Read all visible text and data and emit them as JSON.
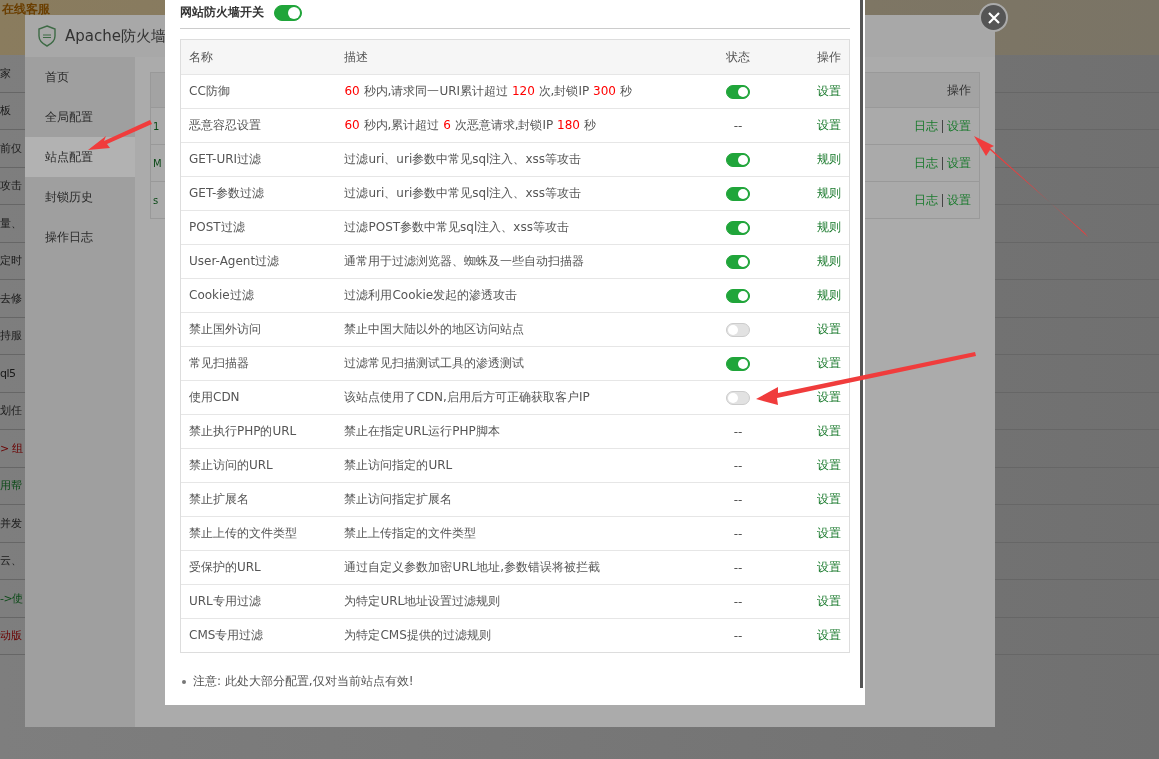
{
  "background_page": {
    "top_link": "在线客服",
    "fragments": [
      {
        "text": "家",
        "kind": "plain"
      },
      {
        "text": "板",
        "kind": "plain"
      },
      {
        "text": "前仅",
        "kind": "plain"
      },
      {
        "text": "攻击",
        "kind": "plain"
      },
      {
        "text": "量、",
        "kind": "plain"
      },
      {
        "text": "定时",
        "kind": "plain"
      },
      {
        "text": "去修",
        "kind": "plain"
      },
      {
        "text": "持服",
        "kind": "plain"
      },
      {
        "text": "ql5",
        "kind": "plain"
      },
      {
        "text": "划任",
        "kind": "plain"
      },
      {
        "text": "> 组",
        "kind": "alert"
      },
      {
        "text": "用帮",
        "kind": "link"
      },
      {
        "text": "并发",
        "kind": "plain"
      },
      {
        "text": "云、",
        "kind": "plain"
      },
      {
        "text": "->使",
        "kind": "link"
      },
      {
        "text": "动版",
        "kind": "alert"
      }
    ]
  },
  "waf_window": {
    "title": "Apache防火墙",
    "sidebar": {
      "items": [
        {
          "label": "首页",
          "selected": false
        },
        {
          "label": "全局配置",
          "selected": false
        },
        {
          "label": "站点配置",
          "selected": true
        },
        {
          "label": "封锁历史",
          "selected": false
        },
        {
          "label": "操作日志",
          "selected": false
        }
      ]
    },
    "sites_table": {
      "columns": [
        "操作"
      ],
      "rows": [
        {
          "column_1": "1",
          "log": "日志",
          "settings": "设置"
        },
        {
          "column_1": "M",
          "log": "日志",
          "settings": "设置"
        },
        {
          "column_1": "s",
          "log": "日志",
          "settings": "设置"
        }
      ]
    }
  },
  "modal": {
    "master_switch": {
      "label": "网站防火墙开关",
      "on": true
    },
    "table": {
      "columns": [
        "名称",
        "描述",
        "状态",
        "操作"
      ],
      "rows": [
        {
          "name": "CC防御",
          "description": [
            {
              "text": "60",
              "kind": "number"
            },
            {
              "text": " 秒内,请求同一URI累计超过 ",
              "kind": "text"
            },
            {
              "text": "120",
              "kind": "number"
            },
            {
              "text": " 次,封锁IP ",
              "kind": "text"
            },
            {
              "text": "300",
              "kind": "number"
            },
            {
              "text": " 秒",
              "kind": "text"
            }
          ],
          "status": {
            "kind": "toggle",
            "on": true
          },
          "action": "设置"
        },
        {
          "name": "恶意容忍设置",
          "description": [
            {
              "text": "60",
              "kind": "number"
            },
            {
              "text": " 秒内,累计超过 ",
              "kind": "text"
            },
            {
              "text": "6",
              "kind": "number"
            },
            {
              "text": " 次恶意请求,封锁IP ",
              "kind": "text"
            },
            {
              "text": "180",
              "kind": "number"
            },
            {
              "text": " 秒",
              "kind": "text"
            }
          ],
          "status": {
            "kind": "text",
            "text": "--"
          },
          "action": "设置"
        },
        {
          "name": "GET-URI过滤",
          "description": [
            {
              "text": "过滤uri、uri参数中常见sql注入、xss等攻击",
              "kind": "text"
            }
          ],
          "status": {
            "kind": "toggle",
            "on": true
          },
          "action": "规则"
        },
        {
          "name": "GET-参数过滤",
          "description": [
            {
              "text": "过滤uri、uri参数中常见sql注入、xss等攻击",
              "kind": "text"
            }
          ],
          "status": {
            "kind": "toggle",
            "on": true
          },
          "action": "规则"
        },
        {
          "name": "POST过滤",
          "description": [
            {
              "text": "过滤POST参数中常见sql注入、xss等攻击",
              "kind": "text"
            }
          ],
          "status": {
            "kind": "toggle",
            "on": true
          },
          "action": "规则"
        },
        {
          "name": "User-Agent过滤",
          "description": [
            {
              "text": "通常用于过滤浏览器、蜘蛛及一些自动扫描器",
              "kind": "text"
            }
          ],
          "status": {
            "kind": "toggle",
            "on": true
          },
          "action": "规则"
        },
        {
          "name": "Cookie过滤",
          "description": [
            {
              "text": "过滤利用Cookie发起的渗透攻击",
              "kind": "text"
            }
          ],
          "status": {
            "kind": "toggle",
            "on": true
          },
          "action": "规则"
        },
        {
          "name": "禁止国外访问",
          "description": [
            {
              "text": "禁止中国大陆以外的地区访问站点",
              "kind": "text"
            }
          ],
          "status": {
            "kind": "toggle",
            "on": false
          },
          "action": "设置"
        },
        {
          "name": "常见扫描器",
          "description": [
            {
              "text": "过滤常见扫描测试工具的渗透测试",
              "kind": "text"
            }
          ],
          "status": {
            "kind": "toggle",
            "on": true
          },
          "action": "设置"
        },
        {
          "name": "使用CDN",
          "description": [
            {
              "text": "该站点使用了CDN,启用后方可正确获取客户IP",
              "kind": "text"
            }
          ],
          "status": {
            "kind": "toggle",
            "on": false
          },
          "action": "设置"
        },
        {
          "name": "禁止执行PHP的URL",
          "description": [
            {
              "text": "禁止在指定URL运行PHP脚本",
              "kind": "text"
            }
          ],
          "status": {
            "kind": "text",
            "text": "--"
          },
          "action": "设置"
        },
        {
          "name": "禁止访问的URL",
          "description": [
            {
              "text": "禁止访问指定的URL",
              "kind": "text"
            }
          ],
          "status": {
            "kind": "text",
            "text": "--"
          },
          "action": "设置"
        },
        {
          "name": "禁止扩展名",
          "description": [
            {
              "text": "禁止访问指定扩展名",
              "kind": "text"
            }
          ],
          "status": {
            "kind": "text",
            "text": "--"
          },
          "action": "设置"
        },
        {
          "name": "禁止上传的文件类型",
          "description": [
            {
              "text": "禁止上传指定的文件类型",
              "kind": "text"
            }
          ],
          "status": {
            "kind": "text",
            "text": "--"
          },
          "action": "设置"
        },
        {
          "name": "受保护的URL",
          "description": [
            {
              "text": "通过自定义参数加密URL地址,参数错误将被拦截",
              "kind": "text"
            }
          ],
          "status": {
            "kind": "text",
            "text": "--"
          },
          "action": "设置"
        },
        {
          "name": "URL专用过滤",
          "description": [
            {
              "text": "为特定URL地址设置过滤规则",
              "kind": "text"
            }
          ],
          "status": {
            "kind": "text",
            "text": "--"
          },
          "action": "设置"
        },
        {
          "name": "CMS专用过滤",
          "description": [
            {
              "text": "为特定CMS提供的过滤规则",
              "kind": "text"
            }
          ],
          "status": {
            "kind": "text",
            "text": "--"
          },
          "action": "设置"
        }
      ]
    },
    "note": "注意: 此处大部分配置,仅对当前站点有效!"
  }
}
